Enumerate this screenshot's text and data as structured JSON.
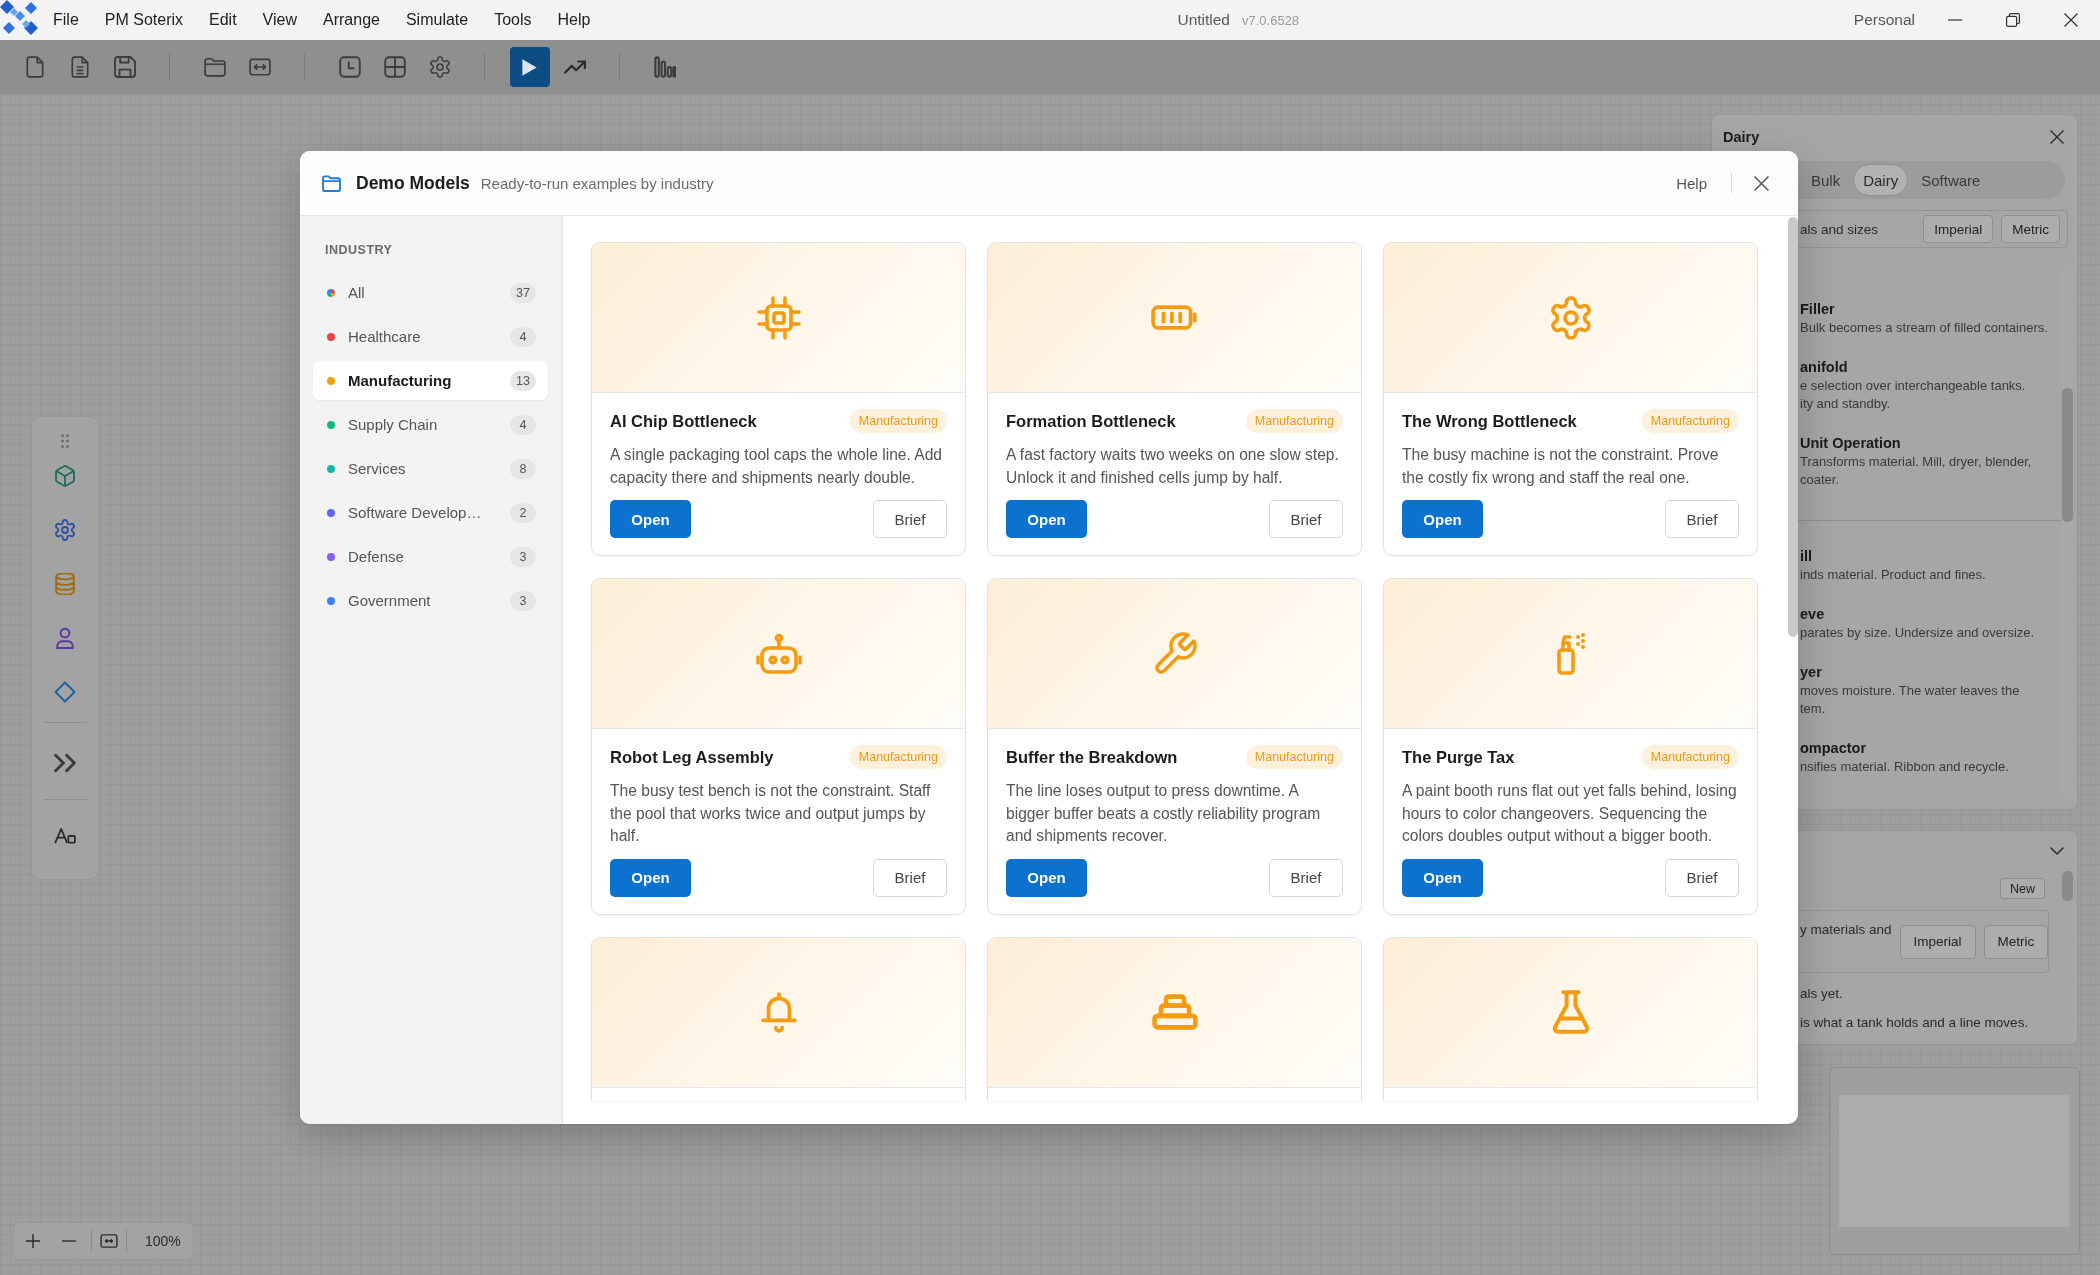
{
  "title_bar": {
    "menus": [
      "File",
      "PM Soterix",
      "Edit",
      "View",
      "Arrange",
      "Simulate",
      "Tools",
      "Help"
    ],
    "document": "Untitled",
    "version": "v7.0.6528",
    "account": "Personal"
  },
  "dialog": {
    "title": "Demo Models",
    "subtitle": "Ready-to-run examples by industry",
    "help": "Help",
    "sidebar": {
      "heading": "INDUSTRY",
      "items": [
        {
          "kind": "all",
          "label": "All",
          "count": "37",
          "selected": false
        },
        {
          "kind": "industry",
          "label": "Healthcare",
          "count": "4",
          "color": "#ef4444",
          "selected": false
        },
        {
          "kind": "industry",
          "label": "Manufacturing",
          "count": "13",
          "color": "#f59e0b",
          "selected": true
        },
        {
          "kind": "industry",
          "label": "Supply Chain",
          "count": "4",
          "color": "#10b981",
          "selected": false
        },
        {
          "kind": "industry",
          "label": "Services",
          "count": "8",
          "color": "#14b8a6",
          "selected": false
        },
        {
          "kind": "industry",
          "label": "Software Develop…",
          "count": "2",
          "color": "#6366f1",
          "selected": false
        },
        {
          "kind": "industry",
          "label": "Defense",
          "count": "3",
          "color": "#8b5cf6",
          "selected": false
        },
        {
          "kind": "industry",
          "label": "Government",
          "count": "3",
          "color": "#3b82f6",
          "selected": false
        }
      ]
    },
    "cards": [
      {
        "kind": "full",
        "title": "AI Chip Bottleneck",
        "tag": "Manufacturing",
        "description": "A single packaging tool caps the whole line. Add capacity there and shipments nearly double.",
        "actions": [
          "Open",
          "Brief"
        ]
      },
      {
        "kind": "full",
        "title": "Formation Bottleneck",
        "tag": "Manufacturing",
        "description": "A fast factory waits two weeks on one slow step. Unlock it and finished cells jump by half.",
        "actions": [
          "Open",
          "Brief"
        ]
      },
      {
        "kind": "full",
        "title": "The Wrong Bottleneck",
        "tag": "Manufacturing",
        "description": "The busy machine is not the constraint. Prove the costly fix wrong and staff the real one.",
        "actions": [
          "Open",
          "Brief"
        ]
      },
      {
        "kind": "full",
        "title": "Robot Leg Assembly",
        "tag": "Manufacturing",
        "description": "The busy test bench is not the constraint. Staff the pool that works twice and output jumps by half.",
        "actions": [
          "Open",
          "Brief"
        ]
      },
      {
        "kind": "full",
        "title": "Buffer the Breakdown",
        "tag": "Manufacturing",
        "description": "The line loses output to press downtime. A bigger buffer beats a costly reliability program and shipments recover.",
        "actions": [
          "Open",
          "Brief"
        ]
      },
      {
        "kind": "full",
        "title": "The Purge Tax",
        "tag": "Manufacturing",
        "description": "A paint booth runs flat out yet falls behind, losing hours to color changeovers. Sequencing the colors doubles output without a bigger booth.",
        "actions": [
          "Open",
          "Brief"
        ]
      },
      {
        "kind": "cut"
      },
      {
        "kind": "cut"
      },
      {
        "kind": "cut"
      }
    ]
  },
  "side_panel": {
    "title": "Dairy",
    "tabs": [
      {
        "label": "Bulk",
        "selected": false
      },
      {
        "label": "Dairy",
        "selected": true
      },
      {
        "label": "Software",
        "selected": false
      }
    ],
    "units_label": "als and sizes",
    "unit_buttons": [
      "Imperial",
      "Metric"
    ],
    "groups": [
      {
        "items": [
          {
            "name": "Filler",
            "lines": [
              "Bulk becomes a stream of filled containers."
            ]
          },
          {
            "name": "anifold",
            "lines": [
              "e selection over interchangeable tanks.",
              "ity and standby."
            ]
          },
          {
            "name": "Unit Operation",
            "lines": [
              "Transforms material. Mill, dryer, blender,",
              "coater."
            ]
          }
        ]
      },
      {
        "items": [
          {
            "name": "ill",
            "lines": [
              "inds material. Product and fines."
            ]
          },
          {
            "name": "eve",
            "lines": [
              "parates by size. Undersize and oversize."
            ]
          },
          {
            "name": "yer",
            "lines": [
              "moves moisture. The water leaves the",
              "tem."
            ]
          },
          {
            "name": "ompactor",
            "lines": [
              "nsifies material. Ribbon and recycle."
            ]
          }
        ]
      }
    ]
  },
  "materials_panel": {
    "new_button": "New",
    "note": "y materials and",
    "unit_buttons": [
      "Imperial",
      "Metric"
    ],
    "lines": [
      "als yet.",
      "is what a tank holds and a line moves."
    ]
  },
  "zoom_control": {
    "value": "100%"
  }
}
